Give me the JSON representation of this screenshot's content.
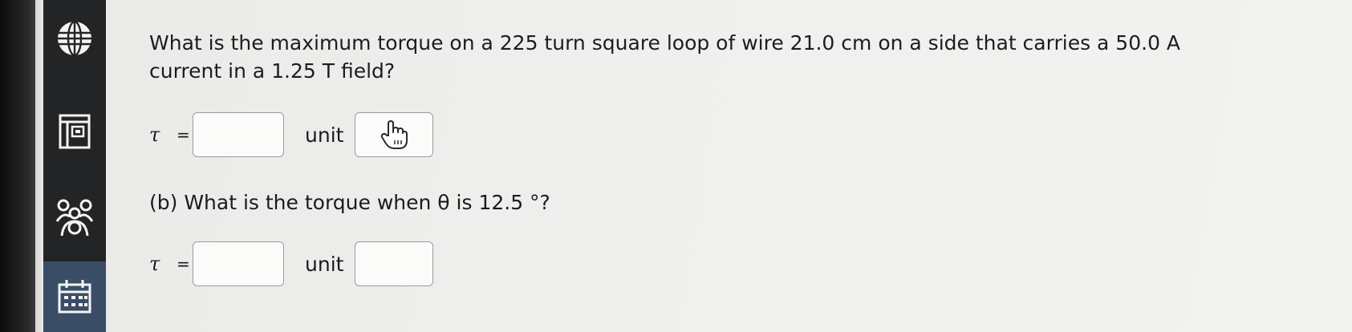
{
  "question": {
    "text": "What is the maximum torque on a 225 turn square loop of wire 21.0 cm on a side that carries a 50.0 A current in a 1.25 T field?"
  },
  "part_a": {
    "symbol": "τ",
    "equals": "=",
    "value": "",
    "unit_label": "unit",
    "unit_value": ""
  },
  "part_b": {
    "text": "(b) What is the torque when θ is 12.5 °?",
    "symbol": "τ",
    "equals": "=",
    "value": "",
    "unit_label": "unit",
    "unit_value": ""
  },
  "sidebar": {
    "items": [
      {
        "icon": "globe-icon"
      },
      {
        "icon": "ebook-icon"
      },
      {
        "icon": "group-icon"
      },
      {
        "icon": "calendar-icon"
      }
    ]
  },
  "colors": {
    "sidebar_bg": "#222426",
    "sidebar_active": "#3a4d66",
    "page_bg": "#efefed"
  }
}
